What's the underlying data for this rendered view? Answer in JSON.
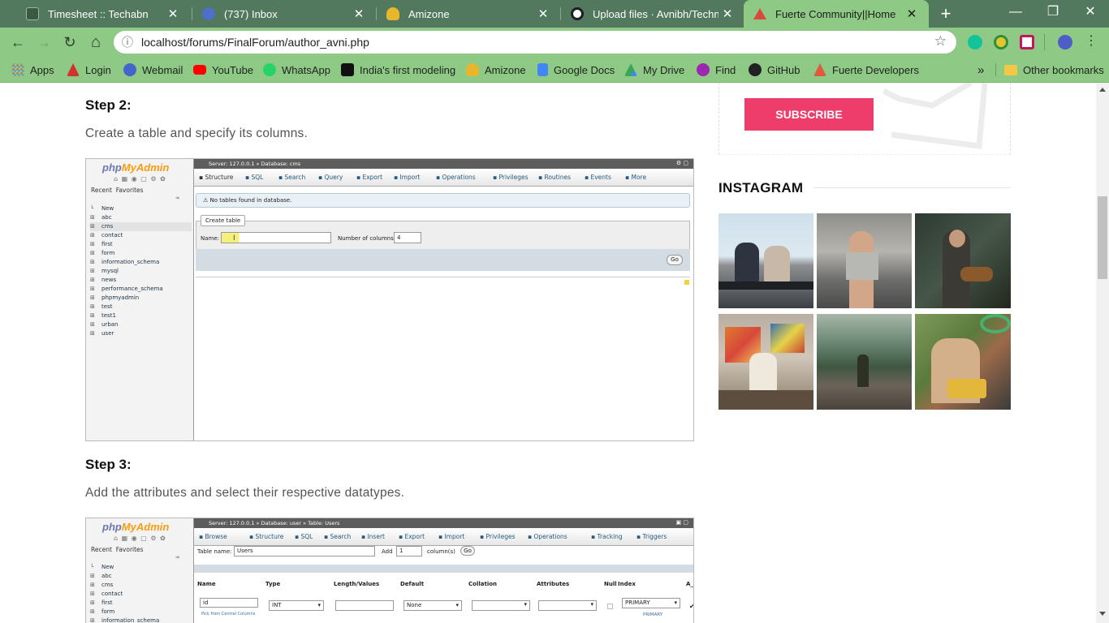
{
  "browser": {
    "tabs": [
      {
        "title": "Timesheet :: Techabn",
        "favicon_color": "#3a5a44"
      },
      {
        "title": "(737) Inbox",
        "favicon_color": "#4f70c9"
      },
      {
        "title": "Amizone",
        "favicon_color": "#e8b62c"
      },
      {
        "title": "Upload files · Avnibh/Technical",
        "favicon_color": "#ffffff"
      },
      {
        "title": "Fuerte Community||Home",
        "favicon_color": "#d94a3c",
        "active": true
      }
    ],
    "new_tab": "+",
    "close_glyph": "✕",
    "window_buttons": {
      "minimize": "—",
      "maximize": "❐",
      "close": "✕"
    },
    "url": "localhost/forums/FinalForum/author_avni.php",
    "nav": {
      "back": "←",
      "forward": "→",
      "reload": "↻",
      "home": "⌂"
    },
    "bookmarks": [
      {
        "label": "Apps",
        "icon_color": "#e04a3f"
      },
      {
        "label": "Login",
        "icon_color": "#d0342c"
      },
      {
        "label": "Webmail",
        "icon_color": "#4466cc"
      },
      {
        "label": "YouTube",
        "icon_color": "#ff0000"
      },
      {
        "label": "WhatsApp",
        "icon_color": "#25d366"
      },
      {
        "label": "India's first modeling",
        "icon_color": "#111111"
      },
      {
        "label": "Amizone",
        "icon_color": "#e8b62c"
      },
      {
        "label": "Google Docs",
        "icon_color": "#4285f4"
      },
      {
        "label": "My Drive",
        "icon_color": "#34a853"
      },
      {
        "label": "Find",
        "icon_color": "#9c27b0"
      },
      {
        "label": "GitHub",
        "icon_color": "#222222"
      },
      {
        "label": "Fuerte Developers",
        "icon_color": "#e05a3f"
      }
    ],
    "bookmarks_overflow": "»",
    "other_bookmarks": "Other bookmarks"
  },
  "article": {
    "step2_title": "Step 2:",
    "step2_text": "Create a table and specify its columns.",
    "step3_title": "Step 3:",
    "step3_text": "Add the attributes and select their respective datatypes."
  },
  "sidebar": {
    "subscribe_label": "SUBSCRIBE",
    "subscribe_color": "#ee3d6b",
    "instagram_title": "INSTAGRAM",
    "instagram_photos": [
      {
        "name": "couple-bench-photo"
      },
      {
        "name": "woman-stretching-photo"
      },
      {
        "name": "guitarist-photo"
      },
      {
        "name": "painter-photo"
      },
      {
        "name": "hiker-coast-photo"
      },
      {
        "name": "headphones-bench-photo"
      }
    ]
  },
  "shot1": {
    "logo_a": "php",
    "logo_b": "MyAdmin",
    "recent": "Recent",
    "favorites": "Favorites",
    "tree": [
      "New",
      "abc",
      "cms",
      "contact",
      "first",
      "form",
      "information_schema",
      "mysql",
      "news",
      "performance_schema",
      "phpmyadmin",
      "test",
      "test1",
      "urban",
      "user"
    ],
    "breadcrumb": "Server: 127.0.0.1 » Database: cms",
    "tabs": [
      "Structure",
      "SQL",
      "Search",
      "Query",
      "Export",
      "Import",
      "Operations",
      "Privileges",
      "Routines",
      "Events",
      "More"
    ],
    "notice": "No tables found in database.",
    "create_table": "Create table",
    "name_label": "Name:",
    "columns_label": "Number of columns:",
    "columns_value": "4",
    "go": "Go"
  },
  "shot2": {
    "logo_a": "php",
    "logo_b": "MyAdmin",
    "recent": "Recent",
    "favorites": "Favorites",
    "tree": [
      "New",
      "abc",
      "cms",
      "contact",
      "first",
      "form",
      "information_schema"
    ],
    "breadcrumb": "Server: 127.0.0.1 » Database: user » Table: Users",
    "tabs": [
      "Browse",
      "Structure",
      "SQL",
      "Search",
      "Insert",
      "Export",
      "Import",
      "Privileges",
      "Operations",
      "Tracking",
      "Triggers"
    ],
    "table_name_label": "Table name:",
    "table_name_value": "Users",
    "add_label": "Add",
    "add_value": "1",
    "columns_label": "column(s)",
    "go": "Go",
    "headers": [
      "Name",
      "Type",
      "Length/Values",
      "Default",
      "Collation",
      "Attributes",
      "Null",
      "Index",
      "A_I"
    ],
    "row_name": "id",
    "row_type": "INT",
    "row_default": "None",
    "row_index": "PRIMARY",
    "central_columns": "Pick from Central Columns",
    "index_sub": "PRIMARY"
  }
}
